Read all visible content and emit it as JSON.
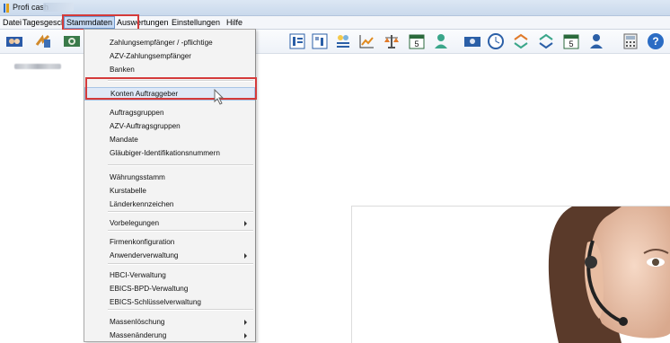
{
  "window": {
    "title": "Profi cash"
  },
  "menubar": {
    "items": [
      "Datei",
      "Tagesgeschäft",
      "Stammdaten",
      "Auswertungen",
      "Einstellungen",
      "Hilfe"
    ],
    "active": "Stammdaten"
  },
  "toolbar": {
    "icons": [
      "users-icon",
      "transfer-icon",
      "cash-icon",
      "spacer",
      "list-icon",
      "table-icon",
      "people-icon",
      "chart-icon",
      "scale-icon",
      "calendar-icon",
      "person-icon",
      "money-icon",
      "clock-icon",
      "swap-icon",
      "swap2-icon",
      "calendar2-icon",
      "person2-icon",
      "calculator-icon",
      "help-icon"
    ]
  },
  "dropdown": {
    "items": [
      {
        "label": "Zahlungsempfänger / -pflichtige",
        "submenu": false
      },
      {
        "label": "AZV-Zahlungsempfänger",
        "submenu": false
      },
      {
        "label": "Banken",
        "submenu": false
      },
      {
        "label": "Konten Auftraggeber",
        "submenu": false,
        "highlighted": true
      },
      {
        "label": "Auftragsgruppen",
        "submenu": false
      },
      {
        "label": "AZV-Auftragsgruppen",
        "submenu": false
      },
      {
        "label": "Mandate",
        "submenu": false
      },
      {
        "label": "Gläubiger-Identifikationsnummern",
        "submenu": false
      },
      {
        "label": "Währungsstamm",
        "submenu": false
      },
      {
        "label": "Kurstabelle",
        "submenu": false
      },
      {
        "label": "Länderkennzeichen",
        "submenu": false
      },
      {
        "label": "Vorbelegungen",
        "submenu": true
      },
      {
        "label": "Firmenkonfiguration",
        "submenu": false
      },
      {
        "label": "Anwenderverwaltung",
        "submenu": true
      },
      {
        "label": "HBCI-Verwaltung",
        "submenu": false
      },
      {
        "label": "EBICS-BPD-Verwaltung",
        "submenu": false
      },
      {
        "label": "EBICS-Schlüsselverwaltung",
        "submenu": false
      },
      {
        "label": "Massenlöschung",
        "submenu": true
      },
      {
        "label": "Massenänderung",
        "submenu": true
      }
    ]
  },
  "colors": {
    "highlight": "#d43a3a",
    "menu_active": "#c6daf4"
  }
}
